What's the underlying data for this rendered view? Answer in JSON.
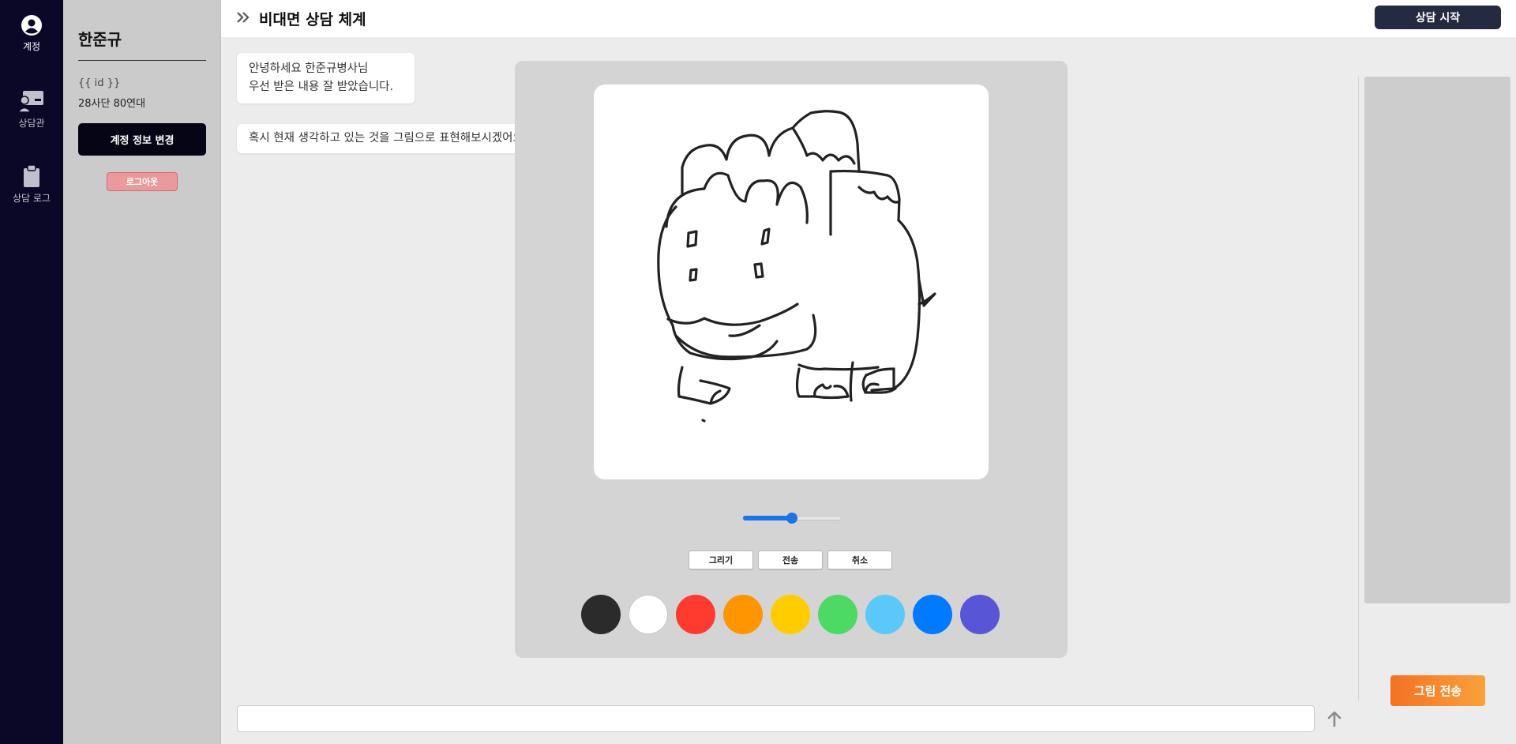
{
  "nav": {
    "items": [
      {
        "label": "계정",
        "icon": "user-circle-icon",
        "active": true
      },
      {
        "label": "상담관",
        "icon": "counselor-icon",
        "active": false
      },
      {
        "label": "상담 로그",
        "icon": "clipboard-icon",
        "active": false
      }
    ]
  },
  "account": {
    "name": "한준규",
    "id": "{{ id }}",
    "info": "28사단 80연대",
    "edit_label": "계정 정보 변경",
    "logout_label": "로그아웃"
  },
  "header": {
    "title": "비대면 상담 체계",
    "start_label": "상담 시작"
  },
  "chat": {
    "messages": [
      {
        "line1": "안녕하세요 한준규병사님",
        "line2": "우선 받은 내용 잘 받았습니다."
      },
      {
        "line1": "혹시 현재 생각하고 있는 것을 그림으로 표현해보시겠어요?"
      }
    ],
    "input_value": "",
    "input_placeholder": ""
  },
  "drawing": {
    "brush_size_fraction": 0.5,
    "tools": {
      "draw_label": "그리기",
      "send_label": "전송",
      "cancel_label": "취소"
    },
    "palette": [
      "#2b2b2b",
      "#ffffff",
      "#ff3b30",
      "#ff9500",
      "#ffcc00",
      "#4cd964",
      "#5ac8fa",
      "#007aff",
      "#5856d6"
    ]
  },
  "send_drawing_label": "그림 전송",
  "colors": {
    "nav_bg": "#0b0827",
    "accent_orange": "#f47124",
    "header_button": "#242a40"
  }
}
